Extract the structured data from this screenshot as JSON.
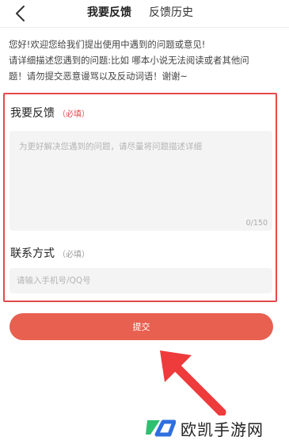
{
  "header": {
    "back_icon": "chevron-left-icon",
    "tabs": [
      {
        "label": "我要反馈",
        "active": true
      },
      {
        "label": "反馈历史",
        "active": false
      }
    ]
  },
  "intro": {
    "lines": [
      "您好!欢迎您给我们提出使用中遇到的问题或意见!",
      "请详细描述您遇到的问题:比如 哪本小说无法阅读或者其他问",
      "题！请勿提交恶意谩骂以及反动词语！谢谢~"
    ]
  },
  "feedback": {
    "title": "我要反馈",
    "required": "（必填）",
    "placeholder": "为更好解决您遇到的问题，请尽量将问题描述详细",
    "value": "",
    "counter": "0/150"
  },
  "contact": {
    "title": "联系方式",
    "required": "（必填）",
    "placeholder": "请输入手机号/QQ号",
    "value": ""
  },
  "submit": {
    "label": "提交"
  },
  "colors": {
    "highlight_border": "#e24b4b",
    "submit_bg": "#e86050",
    "arrow": "#ee3b3b",
    "watermark_green": "#2fbf71",
    "watermark_blue": "#2f6fe0"
  },
  "watermark": {
    "text": "欧凯手游网",
    "logo_icon": "ouka-logo-icon"
  }
}
